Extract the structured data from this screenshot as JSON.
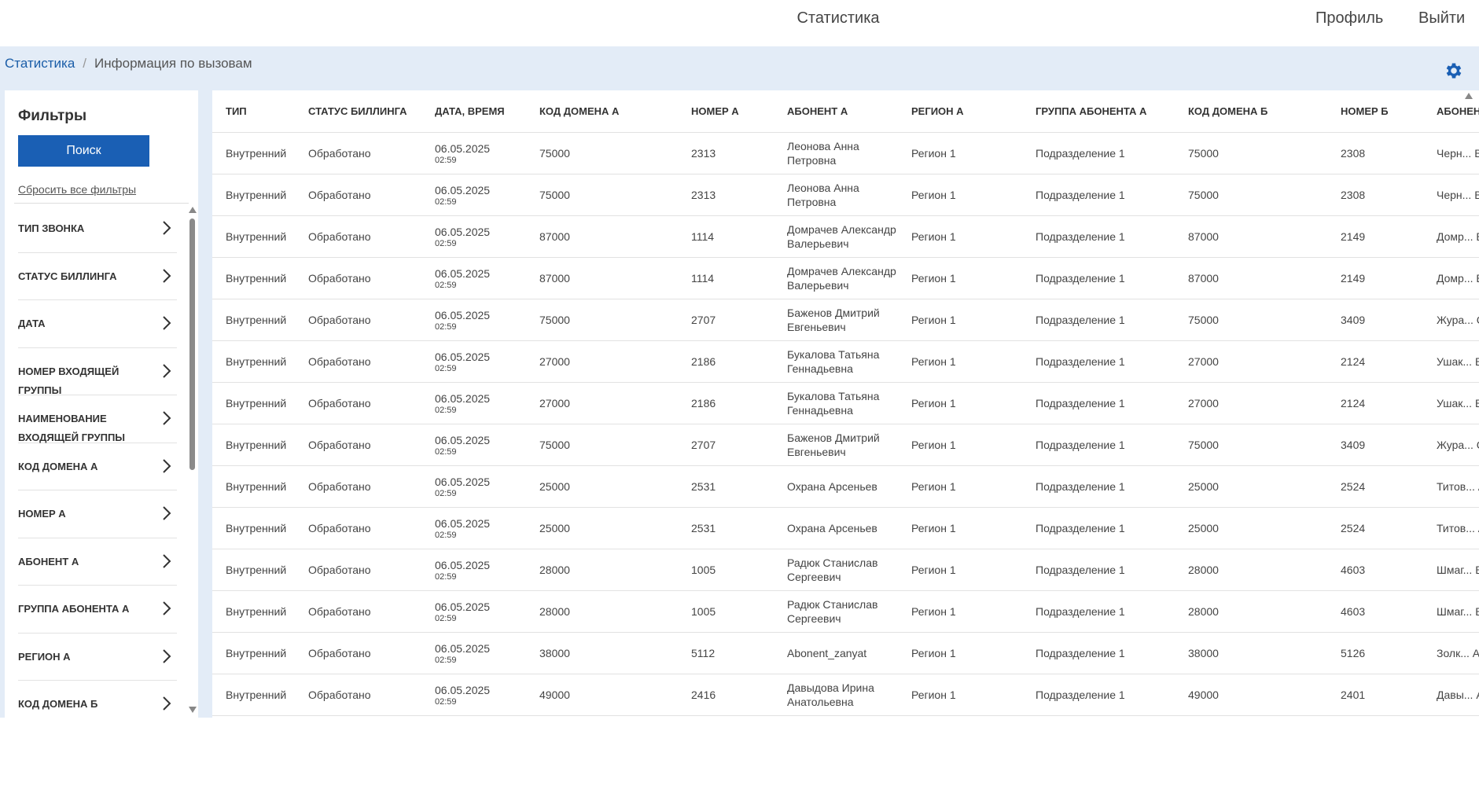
{
  "header": {
    "title": "Статистика",
    "profile_label": "Профиль",
    "logout_label": "Выйти"
  },
  "breadcrumb": {
    "root": "Статистика",
    "current": "Информация по вызовам"
  },
  "sidebar": {
    "title": "Фильтры",
    "search_label": "Поиск",
    "reset_label": "Сбросить все фильтры",
    "filters": [
      "Тип звонка",
      "Статус биллинга",
      "Дата",
      "Номер входящей группы",
      "Наименование входящей группы",
      "Код домена А",
      "Номер А",
      "Абонент А",
      "Группа абонента А",
      "Регион А",
      "Код домена Б"
    ]
  },
  "table": {
    "columns": [
      "Тип",
      "Статус биллинга",
      "Дата, время",
      "Код домена А",
      "Номер А",
      "Абонент А",
      "Регион А",
      "Группа абонента А",
      "Код домена Б",
      "Номер Б",
      "Абонент Б"
    ],
    "rows": [
      [
        "Внутренний",
        "Обработано",
        "06.05.2025",
        "02:59",
        "75000",
        "2313",
        "Леонова Анна Петровна",
        "Регион 1",
        "Подразделение 1",
        "75000",
        "2308",
        "Черн... Викто..."
      ],
      [
        "Внутренний",
        "Обработано",
        "06.05.2025",
        "02:59",
        "75000",
        "2313",
        "Леонова Анна Петровна",
        "Регион 1",
        "Подразделение 1",
        "75000",
        "2308",
        "Черн... Викто..."
      ],
      [
        "Внутренний",
        "Обработано",
        "06.05.2025",
        "02:59",
        "87000",
        "1114",
        "Домрачев Александр Валерьевич",
        "Регион 1",
        "Подразделение 1",
        "87000",
        "2149",
        "Домр... Вале..."
      ],
      [
        "Внутренний",
        "Обработано",
        "06.05.2025",
        "02:59",
        "87000",
        "1114",
        "Домрачев Александр Валерьевич",
        "Регион 1",
        "Подразделение 1",
        "87000",
        "2149",
        "Домр... Вале..."
      ],
      [
        "Внутренний",
        "Обработано",
        "06.05.2025",
        "02:59",
        "75000",
        "2707",
        "Баженов Дмитрий Евгеньевич",
        "Регион 1",
        "Подразделение 1",
        "75000",
        "3409",
        "Жура... Серге..."
      ],
      [
        "Внутренний",
        "Обработано",
        "06.05.2025",
        "02:59",
        "27000",
        "2186",
        "Букалова Татьяна Геннадьевна",
        "Регион 1",
        "Подразделение 1",
        "27000",
        "2124",
        "Ушак... Влад..."
      ],
      [
        "Внутренний",
        "Обработано",
        "06.05.2025",
        "02:59",
        "27000",
        "2186",
        "Букалова Татьяна Геннадьевна",
        "Регион 1",
        "Подразделение 1",
        "27000",
        "2124",
        "Ушак... Влад..."
      ],
      [
        "Внутренний",
        "Обработано",
        "06.05.2025",
        "02:59",
        "75000",
        "2707",
        "Баженов Дмитрий Евгеньевич",
        "Регион 1",
        "Подразделение 1",
        "75000",
        "3409",
        "Жура... Серге..."
      ],
      [
        "Внутренний",
        "Обработано",
        "06.05.2025",
        "02:59",
        "25000",
        "2531",
        "Охрана Арсеньев",
        "Регион 1",
        "Подразделение 1",
        "25000",
        "2524",
        "Титов... Алекс..."
      ],
      [
        "Внутренний",
        "Обработано",
        "06.05.2025",
        "02:59",
        "25000",
        "2531",
        "Охрана Арсеньев",
        "Регион 1",
        "Подразделение 1",
        "25000",
        "2524",
        "Титов... Алекс..."
      ],
      [
        "Внутренний",
        "Обработано",
        "06.05.2025",
        "02:59",
        "28000",
        "1005",
        "Радюк Станислав Сергеевич",
        "Регион 1",
        "Подразделение 1",
        "28000",
        "4603",
        "Шмаг... Викто..."
      ],
      [
        "Внутренний",
        "Обработано",
        "06.05.2025",
        "02:59",
        "28000",
        "1005",
        "Радюк Станислав Сергеевич",
        "Регион 1",
        "Подразделение 1",
        "28000",
        "4603",
        "Шмаг... Викто..."
      ],
      [
        "Внутренний",
        "Обработано",
        "06.05.2025",
        "02:59",
        "38000",
        "5112",
        "Abonent_zanyat",
        "Регион 1",
        "Подразделение 1",
        "38000",
        "5126",
        "Золк... Алекс..."
      ],
      [
        "Внутренний",
        "Обработано",
        "06.05.2025",
        "02:59",
        "49000",
        "2416",
        "Давыдова Ирина Анатольевна",
        "Регион 1",
        "Подразделение 1",
        "49000",
        "2401",
        "Давы... Анато..."
      ]
    ]
  },
  "colors": {
    "accent": "#1a5fb4",
    "link": "#1a5da8",
    "content_bg": "#e3ecf7"
  }
}
